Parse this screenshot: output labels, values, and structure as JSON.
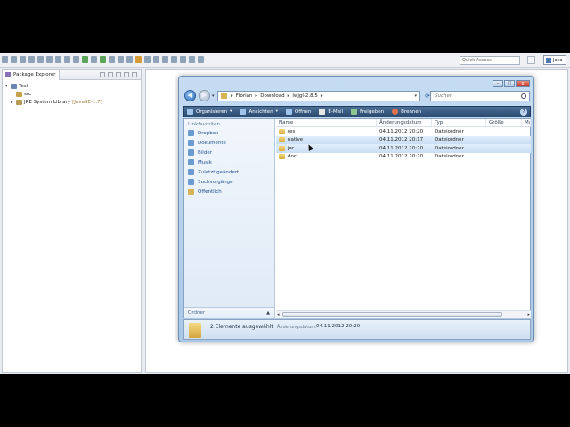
{
  "eclipse": {
    "quick_access": "Quick Access",
    "perspective": "Java",
    "package_explorer": {
      "tab_label": "Package Explorer",
      "tree": [
        {
          "label": "Test",
          "twisty": "▾",
          "icon": "project-icon",
          "decoration": ""
        },
        {
          "label": "src",
          "twisty": "",
          "icon": "package-folder-icon",
          "decoration": ""
        },
        {
          "label": "JRE System Library",
          "twisty": "▸",
          "icon": "library-icon",
          "decoration": "[JavaSE-1.7]"
        }
      ]
    }
  },
  "explorer": {
    "window_controls": {
      "minimize": "–",
      "maximize": "□",
      "close": "x"
    },
    "address": [
      "Florian",
      "Download",
      "lwjgl-2.8.5"
    ],
    "search_placeholder": "Suchen",
    "commands": [
      {
        "label": "Organisieren",
        "dropdown": true,
        "icon": "organize-icon"
      },
      {
        "label": "Ansichten",
        "dropdown": true,
        "icon": "views-icon"
      },
      {
        "label": "Öffnen",
        "dropdown": false,
        "icon": "open-icon"
      },
      {
        "label": "E-Mail",
        "dropdown": false,
        "icon": "email-icon"
      },
      {
        "label": "Freigeben",
        "dropdown": false,
        "icon": "share-icon"
      },
      {
        "label": "Brennen",
        "dropdown": false,
        "icon": "burn-icon"
      }
    ],
    "favorites_header": "Linkfavoriten",
    "favorites": [
      {
        "label": "Dropbox",
        "icon": "dropbox-icon"
      },
      {
        "label": "Dokumente",
        "icon": "documents-icon"
      },
      {
        "label": "Bilder",
        "icon": "pictures-icon"
      },
      {
        "label": "Musik",
        "icon": "music-icon"
      },
      {
        "label": "Zuletzt geändert",
        "icon": "recent-icon"
      },
      {
        "label": "Suchvorgänge",
        "icon": "searches-icon"
      },
      {
        "label": "Öffentlich",
        "icon": "public-folder-icon"
      }
    ],
    "folders_label": "Ordner",
    "columns": {
      "name": "Name",
      "date": "Änderungsdatum",
      "type": "Typ",
      "size": "Größe",
      "more": "Ma"
    },
    "files": [
      {
        "name": "res",
        "date": "04.11.2012 20:20",
        "type": "Dateiordner",
        "size": "",
        "state": ""
      },
      {
        "name": "native",
        "date": "04.11.2012 20:17",
        "type": "Dateiordner",
        "size": "",
        "state": "sel"
      },
      {
        "name": "jar",
        "date": "04.11.2012 20:20",
        "type": "Dateiordner",
        "size": "",
        "state": "sel"
      },
      {
        "name": "doc",
        "date": "04.11.2012 20:20",
        "type": "Dateiordner",
        "size": "",
        "state": ""
      }
    ],
    "details": {
      "summary": "2 Elemente ausgewählt",
      "date_label": "Änderungsdatum:",
      "date_value": "04.11.2012 20:20"
    }
  }
}
